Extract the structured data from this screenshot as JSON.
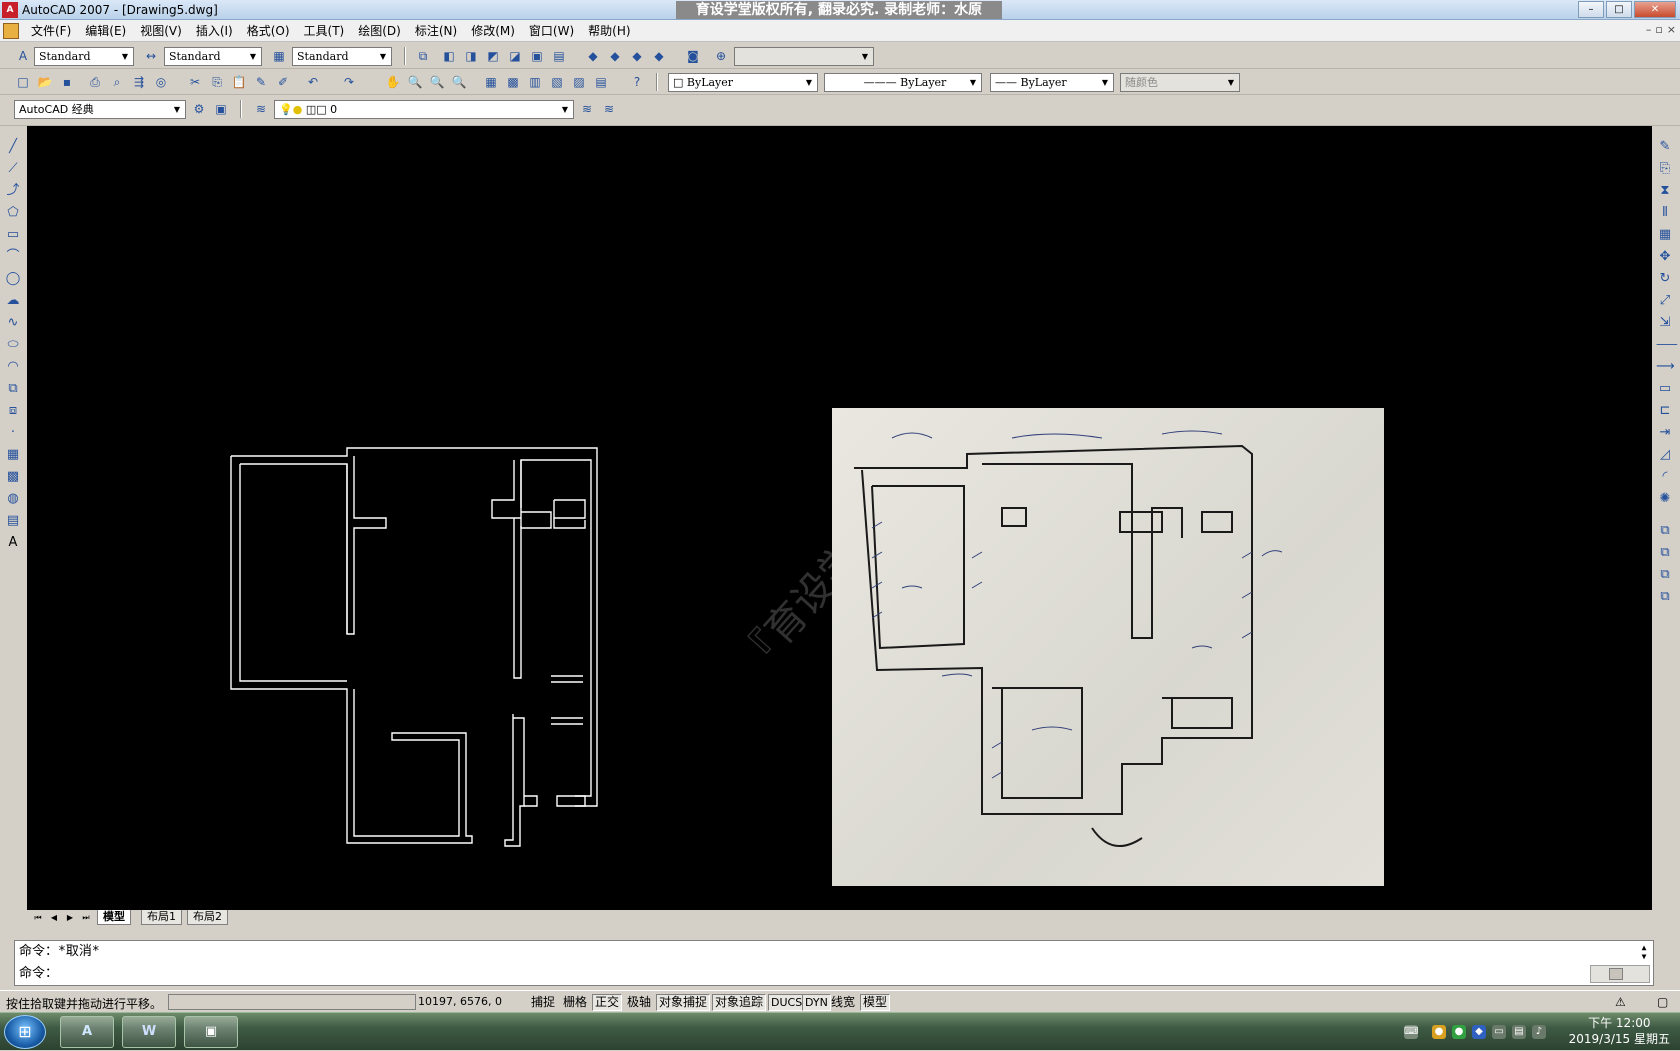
{
  "titlebar": {
    "app_title": "AutoCAD 2007 - [Drawing5.dwg]",
    "banner": "育设学堂版权所有, 翻录必究. 录制老师：水原",
    "minimize": "–",
    "maximize": "□",
    "close": "✕"
  },
  "menubar": {
    "items": [
      {
        "label": "文件(F)"
      },
      {
        "label": "编辑(E)"
      },
      {
        "label": "视图(V)"
      },
      {
        "label": "插入(I)"
      },
      {
        "label": "格式(O)"
      },
      {
        "label": "工具(T)"
      },
      {
        "label": "绘图(D)"
      },
      {
        "label": "标注(N)"
      },
      {
        "label": "修改(M)"
      },
      {
        "label": "窗口(W)"
      },
      {
        "label": "帮助(H)"
      }
    ],
    "mdi_minimize": "–",
    "mdi_restore": "▫",
    "mdi_close": "×"
  },
  "styles_toolbar": {
    "text_style": "Standard",
    "dim_style": "Standard",
    "table_style": "Standard"
  },
  "properties_toolbar": {
    "color": "ByLayer",
    "linetype": "ByLayer",
    "lineweight": "ByLayer",
    "plot_style": "随颜色"
  },
  "workspace_toolbar": {
    "workspace": "AutoCAD 经典",
    "layer": "0"
  },
  "layout_tabs": {
    "model": "模型",
    "layout1": "布局1",
    "layout2": "布局2"
  },
  "command": {
    "history_line": "命令：*取消*",
    "prompt": "命令："
  },
  "status": {
    "message": "按住拾取键并拖动进行平移。",
    "coords": "10197, 6576, 0",
    "toggles": [
      {
        "label": "捕捉",
        "on": false
      },
      {
        "label": "栅格",
        "on": false
      },
      {
        "label": "正交",
        "on": true
      },
      {
        "label": "极轴",
        "on": false
      },
      {
        "label": "对象捕捉",
        "on": true
      },
      {
        "label": "对象追踪",
        "on": true
      },
      {
        "label": "DUCS",
        "on": true
      },
      {
        "label": "DYN",
        "on": true
      },
      {
        "label": "线宽",
        "on": false
      },
      {
        "label": "模型",
        "on": true
      }
    ]
  },
  "taskbar": {
    "time": "下午 12:00",
    "date": "2019/3/15 星期五",
    "app_autocad": "A",
    "app_word": "W"
  },
  "canvas": {
    "watermark": "『育设学"
  }
}
